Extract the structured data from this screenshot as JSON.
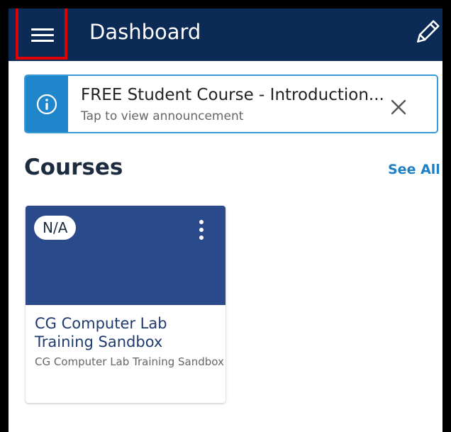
{
  "app_bar": {
    "title": "Dashboard",
    "menu_icon": "hamburger-menu-icon",
    "edit_icon": "pencil-icon",
    "background": "#0b2a55",
    "highlight_color": "#e00000"
  },
  "announcement": {
    "title": "FREE Student Course - Introduction...",
    "subtitle": "Tap to view announcement",
    "icon": "info-icon",
    "close_icon": "close-icon",
    "accent": "#1f86cc"
  },
  "courses": {
    "heading": "Courses",
    "see_all": "See All",
    "items": [
      {
        "badge": "N/A",
        "title": "CG Computer Lab Training Sandbox",
        "subtitle": "CG Computer Lab Training Sandbox",
        "banner_color": "#2b4a8c",
        "menu_icon": "kebab-menu-icon"
      }
    ]
  }
}
